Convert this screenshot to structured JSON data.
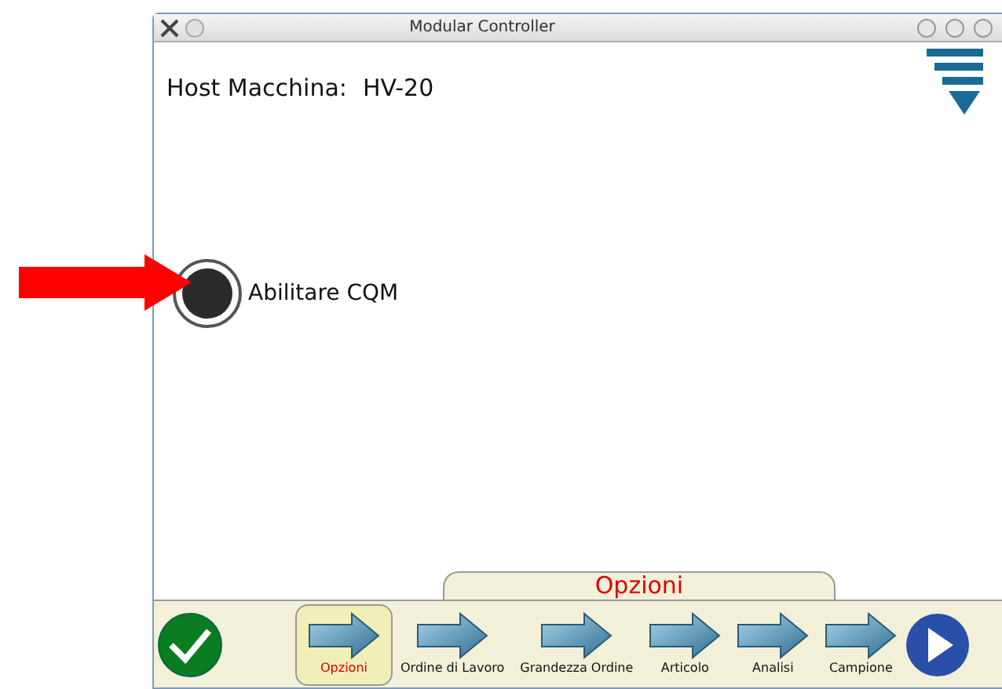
{
  "window": {
    "title": "Modular Controller"
  },
  "host": {
    "label": "Host Macchina:",
    "value": "HV-20"
  },
  "option": {
    "label": "Abilitare CQM",
    "on": true
  },
  "panel_title": "Opzioni",
  "steps": [
    {
      "label": "Opzioni",
      "selected": true
    },
    {
      "label": "Ordine di Lavoro",
      "selected": false
    },
    {
      "label": "Grandezza Ordine",
      "selected": false
    },
    {
      "label": "Articolo",
      "selected": false
    },
    {
      "label": "Analisi",
      "selected": false
    },
    {
      "label": "Campione",
      "selected": false
    }
  ]
}
